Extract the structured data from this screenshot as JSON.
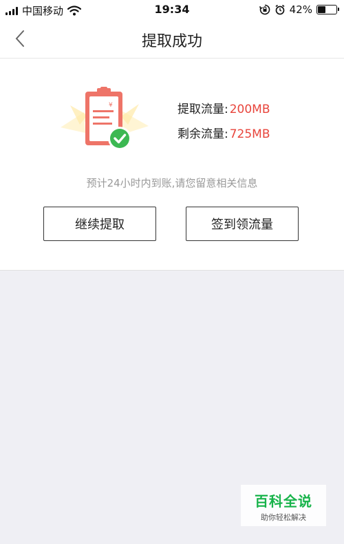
{
  "status_bar": {
    "carrier": "中国移动",
    "time": "19:34",
    "battery_text": "42%",
    "battery_level": 0.42
  },
  "header": {
    "title": "提取成功"
  },
  "result": {
    "extracted_label": "提取流量:",
    "extracted_value": "200MB",
    "remaining_label": "剩余流量:",
    "remaining_value": "725MB",
    "notice": "预计24小时内到账,请您留意相关信息",
    "accent_color": "#e8453c",
    "success_color": "#3cb852"
  },
  "actions": {
    "continue_label": "继续提取",
    "signin_label": "签到领流量"
  },
  "watermark": {
    "brand": "百科全说",
    "slogan": "助你轻松解决"
  }
}
